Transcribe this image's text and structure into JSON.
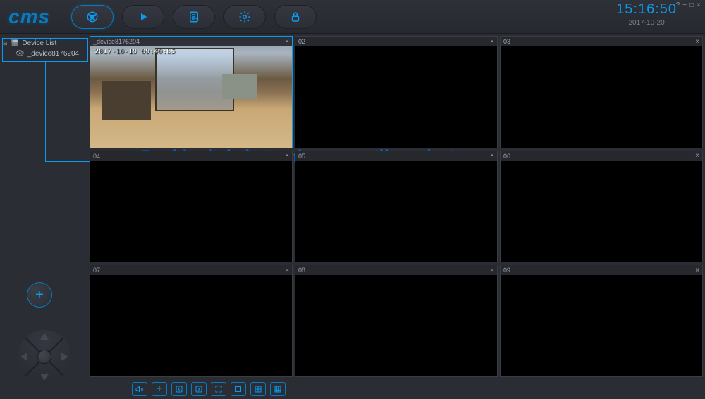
{
  "app": {
    "logo_text": "cms"
  },
  "clock": {
    "time": "15:16:50",
    "date": "2017-10-20"
  },
  "sidebar": {
    "root_label": "Device List",
    "items": [
      {
        "label": "_device8176204"
      }
    ]
  },
  "grid": {
    "cells": [
      {
        "label": "_device8176204",
        "active": true,
        "feed_timestamp": "2017-10-19  09:40:05"
      },
      {
        "label": "02",
        "active": false
      },
      {
        "label": "03",
        "active": false
      },
      {
        "label": "04",
        "active": false
      },
      {
        "label": "05",
        "active": false
      },
      {
        "label": "06",
        "active": false
      },
      {
        "label": "07",
        "active": false
      },
      {
        "label": "08",
        "active": false
      },
      {
        "label": "09",
        "active": false
      }
    ]
  },
  "annotation": {
    "text": "Double click device,then you will see the image."
  },
  "window_controls": {
    "help": "?",
    "min": "−",
    "max": "□",
    "close": "×"
  }
}
